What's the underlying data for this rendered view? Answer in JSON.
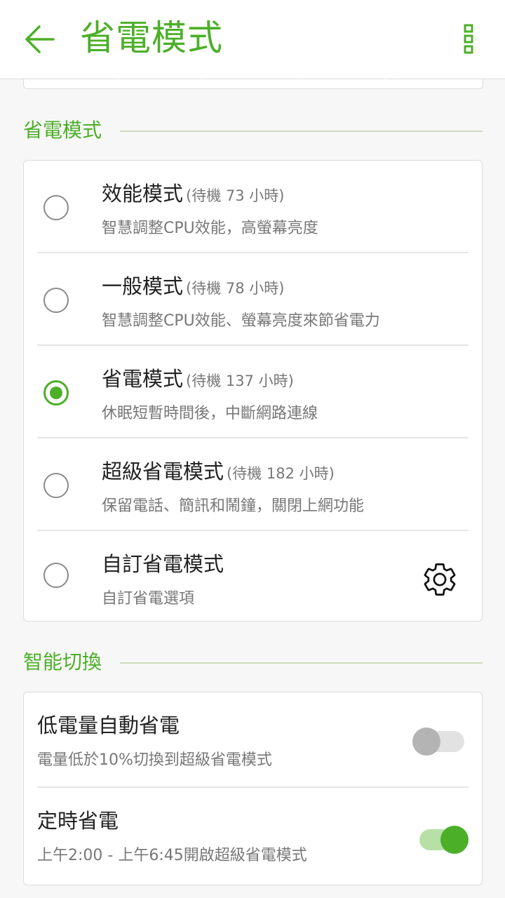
{
  "header": {
    "title": "省電模式",
    "back_icon": "arrow-left-icon",
    "menu_icon": "more-vertical-icon"
  },
  "sections": {
    "power_modes": {
      "label": "省電模式",
      "items": [
        {
          "name": "效能模式",
          "standby": "(待機 73 小時)",
          "desc": "智慧調整CPU效能，高螢幕亮度",
          "selected": false
        },
        {
          "name": "一般模式",
          "standby": "(待機 78 小時)",
          "desc": "智慧調整CPU效能、螢幕亮度來節省電力",
          "selected": false
        },
        {
          "name": "省電模式",
          "standby": "(待機 137 小時)",
          "desc": "休眠短暫時間後，中斷網路連線",
          "selected": true
        },
        {
          "name": "超級省電模式",
          "standby": "(待機 182 小時)",
          "desc": "保留電話、簡訊和鬧鐘，關閉上網功能",
          "selected": false
        },
        {
          "name": "自訂省電模式",
          "standby": "",
          "desc": "自訂省電選項",
          "selected": false
        }
      ]
    },
    "smart_switch": {
      "label": "智能切換",
      "items": [
        {
          "title": "低電量自動省電",
          "desc": "電量低於10%切換到超級省電模式",
          "enabled": false
        },
        {
          "title": "定時省電",
          "desc": "上午2:00 - 上午6:45開啟超級省電模式",
          "enabled": true
        }
      ]
    }
  },
  "colors": {
    "accent": "#4caf28",
    "background": "#f7f7f7",
    "card": "#ffffff",
    "secondary_text": "#777777"
  }
}
